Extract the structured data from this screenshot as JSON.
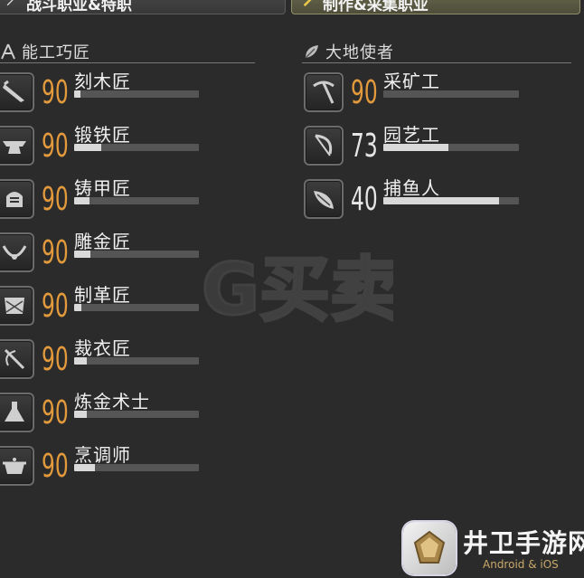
{
  "tabs": [
    {
      "label": "战斗职业&特职",
      "icon": "sword-icon"
    },
    {
      "label": "制作&采集职业",
      "icon": "hammer-icon"
    }
  ],
  "sections": {
    "crafters": {
      "title": "能工巧匠",
      "icon": "compass-icon"
    },
    "gatherers": {
      "title": "大地使者",
      "icon": "leaf-icon"
    }
  },
  "crafters": [
    {
      "name": "刻木匠",
      "level": "90",
      "max": true,
      "progress": 0.05,
      "icon": "saw-icon"
    },
    {
      "name": "锻铁匠",
      "level": "90",
      "max": true,
      "progress": 0.22,
      "icon": "anvil-icon"
    },
    {
      "name": "铸甲匠",
      "level": "90",
      "max": true,
      "progress": 0.12,
      "icon": "helmet-icon"
    },
    {
      "name": "雕金匠",
      "level": "90",
      "max": true,
      "progress": 0.13,
      "icon": "necklace-icon"
    },
    {
      "name": "制革匠",
      "level": "90",
      "max": true,
      "progress": 0.06,
      "icon": "leather-icon"
    },
    {
      "name": "裁衣匠",
      "level": "90",
      "max": true,
      "progress": 0.1,
      "icon": "needle-icon"
    },
    {
      "name": "炼金术士",
      "level": "90",
      "max": true,
      "progress": 0.1,
      "icon": "flask-icon"
    },
    {
      "name": "烹调师",
      "level": "90",
      "max": true,
      "progress": 0.17,
      "icon": "pot-icon"
    }
  ],
  "gatherers": [
    {
      "name": "采矿工",
      "level": "90",
      "max": true,
      "progress": 0.0,
      "icon": "pickaxe-icon"
    },
    {
      "name": "园艺工",
      "level": "73",
      "max": false,
      "progress": 0.48,
      "icon": "sickle-icon"
    },
    {
      "name": "捕鱼人",
      "level": "40",
      "max": false,
      "progress": 0.85,
      "icon": "fish-icon"
    }
  ],
  "watermark": {
    "text": "G买卖"
  },
  "badge": {
    "brand": "井卫手游网",
    "sub": "Android & iOS",
    "icon": "gem-icon"
  },
  "colors": {
    "max_level": "#e39a3c",
    "normal_level": "#e6e6e6",
    "bar_fill": "#d9d9d9",
    "bar_bg": "#555555"
  }
}
